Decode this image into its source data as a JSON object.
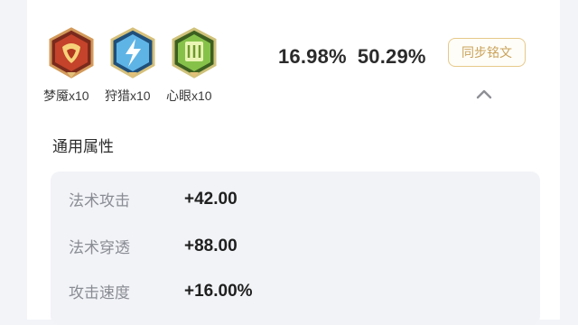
{
  "runes": {
    "items": [
      {
        "label": "梦魇x10",
        "icon": "red-rune-icon",
        "color": "#c4432a"
      },
      {
        "label": "狩猎x10",
        "icon": "blue-rune-icon",
        "color": "#3c9ad6"
      },
      {
        "label": "心眼x10",
        "icon": "green-rune-icon",
        "color": "#6fa83a"
      }
    ]
  },
  "stats": {
    "pct_1": "16.98%",
    "pct_2": "50.29%"
  },
  "sync_button": {
    "label": "同步铭文"
  },
  "section": {
    "title": "通用属性"
  },
  "attributes": [
    {
      "name": "法术攻击",
      "value": "+42.00"
    },
    {
      "name": "法术穿透",
      "value": "+88.00"
    },
    {
      "name": "攻击速度",
      "value": "+16.00%"
    }
  ],
  "colors": {
    "accent_gold": "#c9a25a",
    "panel_bg": "#f2f3f7"
  }
}
